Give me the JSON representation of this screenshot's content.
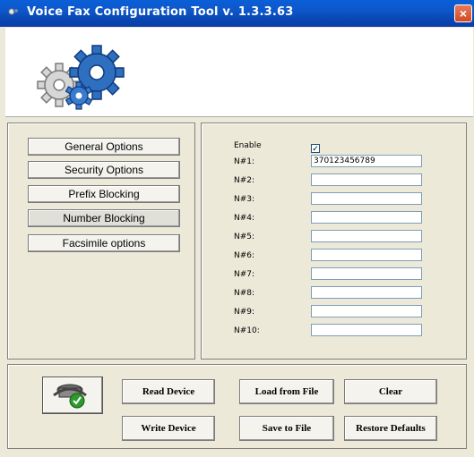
{
  "window": {
    "title": "Voice Fax Configuration Tool v. 1.3.3.63",
    "close_label": "×"
  },
  "options": [
    {
      "label": "General Options"
    },
    {
      "label": "Security Options"
    },
    {
      "label": "Prefix Blocking"
    },
    {
      "label": "Number Blocking",
      "active": true
    },
    {
      "label": "Facsimile options"
    }
  ],
  "blocking": {
    "enable_label": "Enable",
    "enable_checked": true,
    "check_mark": "✓",
    "numbers": [
      {
        "label": "N#1:",
        "value": "370123456789"
      },
      {
        "label": "N#2:",
        "value": ""
      },
      {
        "label": "N#3:",
        "value": ""
      },
      {
        "label": "N#4:",
        "value": ""
      },
      {
        "label": "N#5:",
        "value": ""
      },
      {
        "label": "N#6:",
        "value": ""
      },
      {
        "label": "N#7:",
        "value": ""
      },
      {
        "label": "N#8:",
        "value": ""
      },
      {
        "label": "N#9:",
        "value": ""
      },
      {
        "label": "N#10:",
        "value": ""
      }
    ]
  },
  "actions": {
    "read_device": "Read Device",
    "load_from_file": "Load from File",
    "clear": "Clear",
    "write_device": "Write Device",
    "save_to_file": "Save to File",
    "restore_defaults": "Restore Defaults"
  },
  "icons": {
    "banner": "gears-icon",
    "device": "modem-check-icon"
  },
  "colors": {
    "titlebar": "#0a47b3",
    "window_bg": "#ece9d8",
    "gear_blue": "#1f5fa8"
  }
}
